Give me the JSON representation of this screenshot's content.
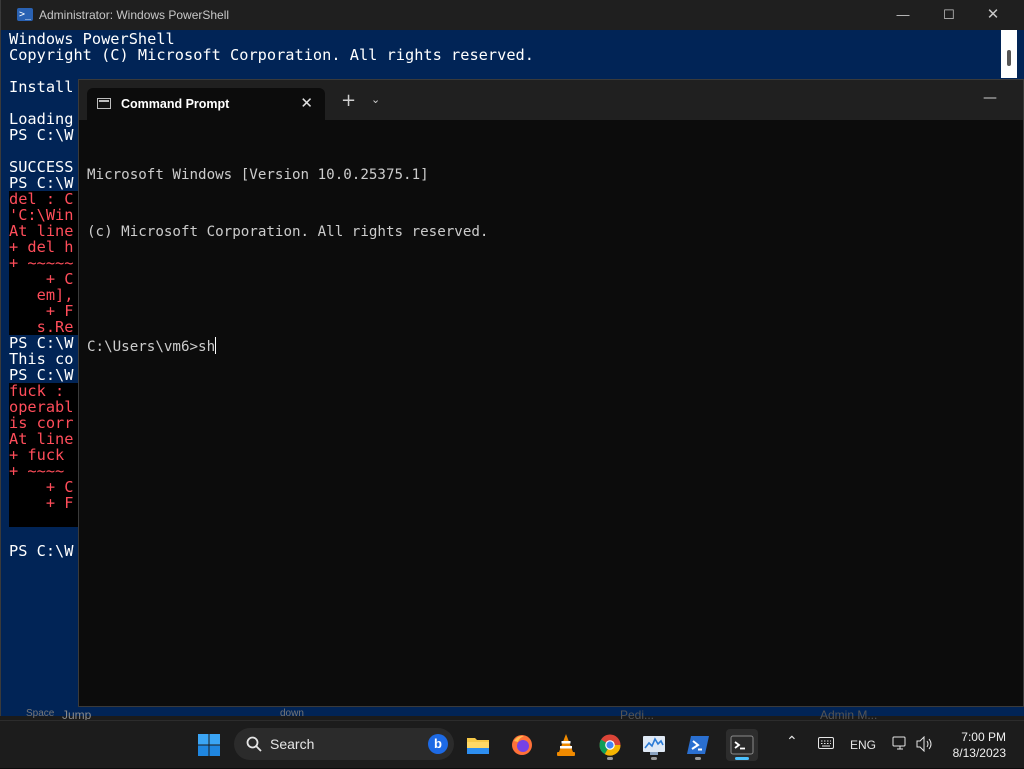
{
  "powershell": {
    "title": "Administrator: Windows PowerShell",
    "title_icon": "powershell-icon",
    "lines": [
      {
        "text": "Windows PowerShell",
        "style": "white"
      },
      {
        "text": "Copyright (C) Microsoft Corporation. All rights reserved.",
        "style": "white"
      },
      {
        "text": "",
        "style": "white"
      },
      {
        "text": "Install",
        "style": "white"
      },
      {
        "text": "",
        "style": "white"
      },
      {
        "text": "Loading",
        "style": "white"
      },
      {
        "text": "PS C:\\W",
        "style": "white"
      },
      {
        "text": "",
        "style": "white"
      },
      {
        "text": "SUCCESS",
        "style": "white"
      },
      {
        "text": "PS C:\\W",
        "style": "white"
      },
      {
        "text": "del : C",
        "style": "red"
      },
      {
        "text": "'C:\\Win",
        "style": "red"
      },
      {
        "text": "At line",
        "style": "red"
      },
      {
        "text": "+ del h",
        "style": "red"
      },
      {
        "text": "+ ~~~~~",
        "style": "red"
      },
      {
        "text": "    + C",
        "style": "red"
      },
      {
        "text": "   em],",
        "style": "red"
      },
      {
        "text": "    + F",
        "style": "red"
      },
      {
        "text": "   s.Re",
        "style": "red"
      },
      {
        "text": "PS C:\\W",
        "style": "white"
      },
      {
        "text": "This co",
        "style": "white"
      },
      {
        "text": "PS C:\\W",
        "style": "white"
      },
      {
        "text": "fuck : ",
        "style": "red"
      },
      {
        "text": "operabl",
        "style": "red"
      },
      {
        "text": "is corr",
        "style": "red"
      },
      {
        "text": "At line",
        "style": "red"
      },
      {
        "text": "+ fuck ",
        "style": "red"
      },
      {
        "text": "+ ~~~~",
        "style": "red"
      },
      {
        "text": "    + C",
        "style": "red"
      },
      {
        "text": "    + F",
        "style": "red"
      },
      {
        "text": "",
        "style": "redbg"
      },
      {
        "text": "",
        "style": "white"
      },
      {
        "text": "PS C:\\W",
        "style": "white"
      }
    ]
  },
  "terminal": {
    "tab_title": "Command Prompt",
    "tab_icon": "cmd-icon",
    "new_tab_label": "+",
    "lines": [
      "Microsoft Windows [Version 10.0.25375.1]",
      "(c) Microsoft Corporation. All rights reserved.",
      ""
    ],
    "prompt": "C:\\Users\\vm6>",
    "input": "sh"
  },
  "desktop_hints": {
    "left": "Jump",
    "left_prefix": "Space",
    "mid": "down",
    "right1": "Pedi...",
    "right2": "Admin M..."
  },
  "taskbar": {
    "search_label": "Search",
    "apps": [
      {
        "name": "start-button",
        "icon": "windows-logo-icon",
        "active": false,
        "running": false
      },
      {
        "name": "file-explorer",
        "icon": "folder-icon",
        "active": false,
        "running": false
      },
      {
        "name": "firefox",
        "icon": "firefox-icon",
        "active": false,
        "running": false
      },
      {
        "name": "vlc",
        "icon": "vlc-cone-icon",
        "active": false,
        "running": false
      },
      {
        "name": "chrome",
        "icon": "chrome-icon",
        "active": false,
        "running": true
      },
      {
        "name": "resource-monitor",
        "icon": "monitor-chart-icon",
        "active": false,
        "running": true
      },
      {
        "name": "powershell",
        "icon": "powershell-icon",
        "active": false,
        "running": true
      },
      {
        "name": "terminal",
        "icon": "terminal-icon",
        "active": true,
        "running": true
      }
    ],
    "language": "ENG",
    "time": "7:00 PM",
    "date": "8/13/2023"
  }
}
